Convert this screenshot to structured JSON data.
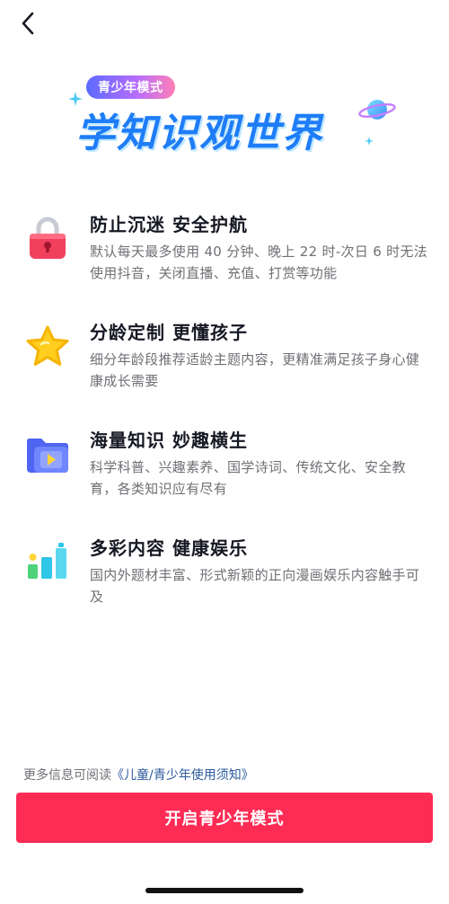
{
  "hero": {
    "badge": "青少年模式",
    "title": "学知识观世界"
  },
  "features": [
    {
      "icon": "lock-icon",
      "title": "防止沉迷 安全护航",
      "desc": "默认每天最多使用 40 分钟、晚上 22 时-次日 6 时无法使用抖音，关闭直播、充值、打赏等功能"
    },
    {
      "icon": "star-icon",
      "title": "分龄定制 更懂孩子",
      "desc": "细分年龄段推荐适龄主题内容，更精准满足孩子身心健康成长需要"
    },
    {
      "icon": "video-folder-icon",
      "title": "海量知识 妙趣横生",
      "desc": "科学科普、兴趣素养、国学诗词、传统文化、安全教育，各类知识应有尽有"
    },
    {
      "icon": "bar-chart-icon",
      "title": "多彩内容 健康娱乐",
      "desc": "国内外题材丰富、形式新颖的正向漫画娱乐内容触手可及"
    }
  ],
  "footer": {
    "info_prefix": "更多信息可阅读",
    "info_link": "《儿童/青少年使用须知》",
    "button_label": "开启青少年模式"
  },
  "colors": {
    "primary": "#fe2c55",
    "title_blue": "#1e7df7",
    "link": "#2b5a9c"
  }
}
